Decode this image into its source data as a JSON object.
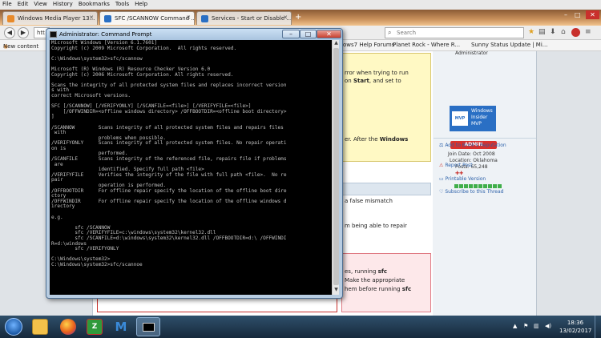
{
  "menubar": [
    "File",
    "Edit",
    "View",
    "History",
    "Bookmarks",
    "Tools",
    "Help"
  ],
  "tabs": [
    {
      "label": "Windows Media Player 13...",
      "color": "#e88a2a"
    },
    {
      "label": "SFC /SCANNOW Command ...",
      "color": "#2a6fc4"
    },
    {
      "label": "Services - Start or Disable ...",
      "color": "#2a6fc4"
    }
  ],
  "nav": {
    "url": "htt",
    "search_placeholder": "Search"
  },
  "bookmarks": {
    "left": "New content",
    "right": "ows7 Help Forums",
    "b2": "Planet Rock - Where R...",
    "b3": "Sunny Status Update | Mi..."
  },
  "page": {
    "y1": "rror when trying to run",
    "y2a": "on ",
    "y2b": "Start",
    "y2c": ", and set to",
    "y3a": "er. After the ",
    "y3b": "Windows",
    "g1": "a false mismatch",
    "g2": "m being able to repair",
    "p1a": "es, running ",
    "p1b": "sfc",
    "p2": "Make the appropriate",
    "p3a": "hem before running ",
    "p3b": "sfc"
  },
  "sidebar": {
    "mvp_line1": "Windows",
    "mvp_line2": "Insider",
    "mvp_line3": "MVP",
    "mvp_badge": "MVP",
    "role_top": "Administrator",
    "admin": "ADMIN",
    "join": "Join Date: Oct 2008",
    "location": "Location: Oklahoma",
    "posts": "Posts: 65,248",
    "links": [
      "Add to Brink's Reputation",
      "Report Post",
      "Printable Version",
      "Subscribe to this Thread"
    ]
  },
  "cmd": {
    "title": "Administrator: Command Prompt",
    "lines": [
      "Microsoft Windows [Version 6.1.7601]",
      "Copyright (c) 2009 Microsoft Corporation.  All rights reserved.",
      "",
      "C:\\Windows\\system32>sfc/scannow",
      "",
      "Microsoft (R) Windows (R) Resource Checker Version 6.0",
      "Copyright (c) 2006 Microsoft Corporation. All rights reserved.",
      "",
      "Scans the integrity of all protected system files and replaces incorrect version",
      "s with",
      "correct Microsoft versions.",
      "",
      "SFC [/SCANNOW] [/VERIFYONLY] [/SCANFILE=<file>] [/VERIFYFILE=<file>]",
      "    [/OFFWINDIR=<offline windows directory> /OFFBOOTDIR=<offline boot directory>",
      "]",
      "",
      "/SCANNOW        Scans integrity of all protected system files and repairs files",
      " with",
      "                problems when possible.",
      "/VERIFYONLY     Scans integrity of all protected system files. No repair operati",
      "on is",
      "                performed.",
      "/SCANFILE       Scans integrity of the referenced file, repairs file if problems",
      " are",
      "                identified. Specify full path <file>",
      "/VERIFYFILE     Verifies the integrity of the file with full path <file>.  No re",
      "pair",
      "                operation is performed.",
      "/OFFBOOTDIR     For offline repair specify the location of the offline boot dire",
      "ctory",
      "/OFFWINDIR      For offline repair specify the location of the offline windows d",
      "irectory",
      "",
      "e.g.",
      "",
      "        sfc /SCANNOW",
      "        sfc /VERIFYFILE=c:\\windows\\system32\\kernel32.dll",
      "        sfc /SCANFILE=d:\\windows\\system32\\kernel32.dll /OFFBOOTDIR=d:\\ /OFFWINDI",
      "R=d:\\windows",
      "        sfc /VERIFYONLY",
      "",
      "C:\\Windows\\system32>",
      "C:\\Windows\\system32>sfc/scannoe"
    ]
  },
  "taskbar": {
    "time": "18:36",
    "date": "13/02/2017"
  }
}
